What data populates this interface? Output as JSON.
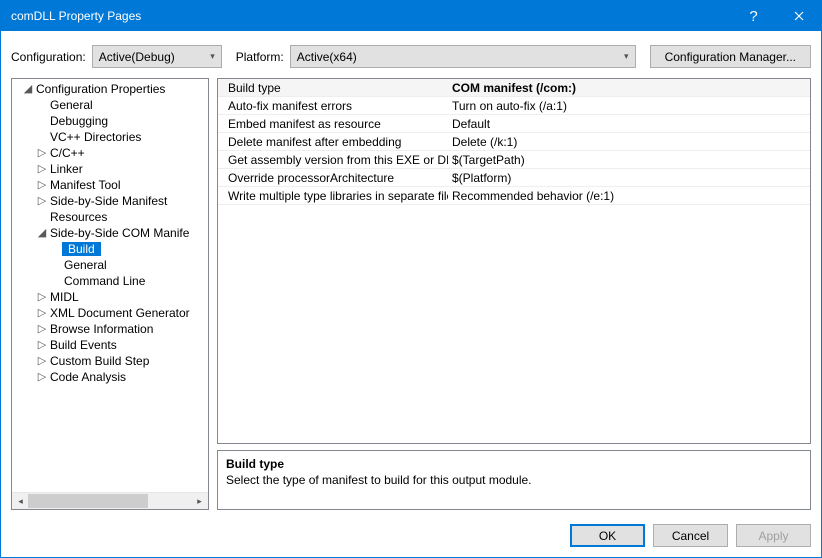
{
  "title": "comDLL Property Pages",
  "configRow": {
    "configLabel": "Configuration:",
    "configValue": "Active(Debug)",
    "platformLabel": "Platform:",
    "platformValue": "Active(x64)",
    "managerBtn": "Configuration Manager..."
  },
  "tree": [
    {
      "depth": 0,
      "exp": "◢",
      "label": "Configuration Properties"
    },
    {
      "depth": 1,
      "exp": "",
      "label": "General"
    },
    {
      "depth": 1,
      "exp": "",
      "label": "Debugging"
    },
    {
      "depth": 1,
      "exp": "",
      "label": "VC++ Directories"
    },
    {
      "depth": 1,
      "exp": "▷",
      "label": "C/C++"
    },
    {
      "depth": 1,
      "exp": "▷",
      "label": "Linker"
    },
    {
      "depth": 1,
      "exp": "▷",
      "label": "Manifest Tool"
    },
    {
      "depth": 1,
      "exp": "▷",
      "label": "Side-by-Side Manifest"
    },
    {
      "depth": 1,
      "exp": "",
      "label": "Resources"
    },
    {
      "depth": 1,
      "exp": "◢",
      "label": "Side-by-Side COM Manife"
    },
    {
      "depth": 2,
      "exp": "",
      "label": "Build",
      "selected": true
    },
    {
      "depth": 2,
      "exp": "",
      "label": "General"
    },
    {
      "depth": 2,
      "exp": "",
      "label": "Command Line"
    },
    {
      "depth": 1,
      "exp": "▷",
      "label": "MIDL"
    },
    {
      "depth": 1,
      "exp": "▷",
      "label": "XML Document Generator"
    },
    {
      "depth": 1,
      "exp": "▷",
      "label": "Browse Information"
    },
    {
      "depth": 1,
      "exp": "▷",
      "label": "Build Events"
    },
    {
      "depth": 1,
      "exp": "▷",
      "label": "Custom Build Step"
    },
    {
      "depth": 1,
      "exp": "▷",
      "label": "Code Analysis"
    }
  ],
  "props": [
    {
      "name": "Build type",
      "value": "COM manifest (/com:)",
      "selected": true
    },
    {
      "name": "Auto-fix manifest errors",
      "value": "Turn on auto-fix (/a:1)"
    },
    {
      "name": "Embed manifest as resource",
      "value": "Default"
    },
    {
      "name": "Delete manifest after embedding",
      "value": "Delete (/k:1)"
    },
    {
      "name": "Get assembly version from this EXE or DLL",
      "value": "$(TargetPath)"
    },
    {
      "name": "Override processorArchitecture",
      "value": "$(Platform)"
    },
    {
      "name": "Write multiple type libraries in separate file",
      "value": "Recommended behavior (/e:1)"
    }
  ],
  "desc": {
    "title": "Build type",
    "text": "Select the type of manifest to build for this output module."
  },
  "footer": {
    "ok": "OK",
    "cancel": "Cancel",
    "apply": "Apply"
  }
}
